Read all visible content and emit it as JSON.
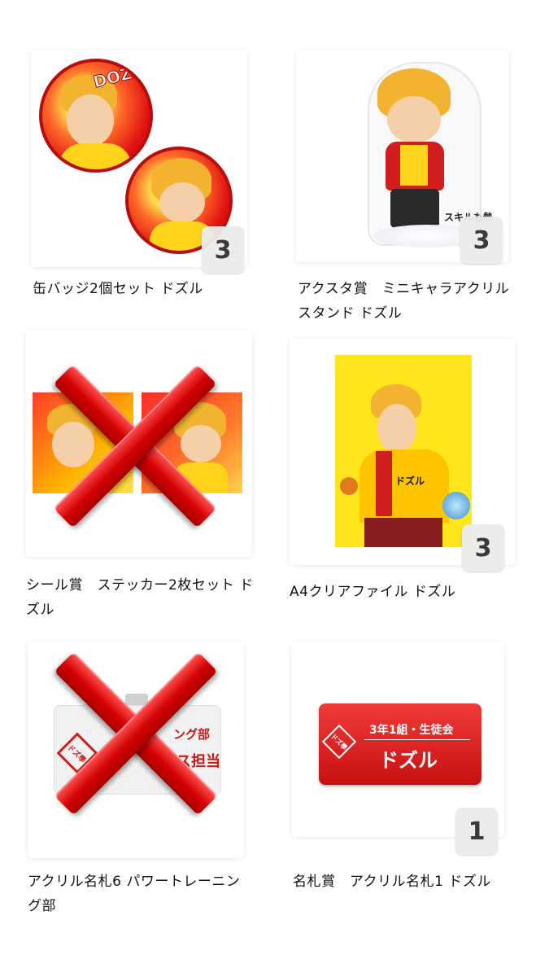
{
  "items": [
    {
      "caption": "缶バッジ2個セット ドズル",
      "quantity": "3",
      "crossed_out": false,
      "image": "can-badge-set"
    },
    {
      "caption": "アクスタ賞　ミニキャラアクリルスタンド ドズル",
      "quantity": "3",
      "crossed_out": false,
      "image": "acrylic-stand"
    },
    {
      "caption": "シール賞　ステッカー2枚セット ドズル",
      "quantity": "",
      "crossed_out": true,
      "image": "sticker-set"
    },
    {
      "caption": "A4クリアファイル ドズル",
      "quantity": "3",
      "crossed_out": false,
      "image": "clear-file"
    },
    {
      "caption": "アクリル名札6 パワートレーニング部",
      "quantity": "",
      "crossed_out": true,
      "image": "acrylic-nameplate-6"
    },
    {
      "caption": "名札賞　アクリル名札1 ドズル",
      "quantity": "1",
      "crossed_out": false,
      "image": "acrylic-nameplate-1"
    }
  ],
  "art": {
    "badge_text": "DOZLE",
    "stand_logo": "スキルも熱",
    "file_towel": "ドズル",
    "nameplate6_line1": "ング部",
    "nameplate6_line2": "ス担当",
    "nameplate1_line1": "3年1組・生徒会",
    "nameplate1_line2": "ドズル",
    "school_mark": "ドズ學"
  },
  "colors": {
    "accent_red": "#d40000",
    "badge_bg": "#ebebeb"
  }
}
